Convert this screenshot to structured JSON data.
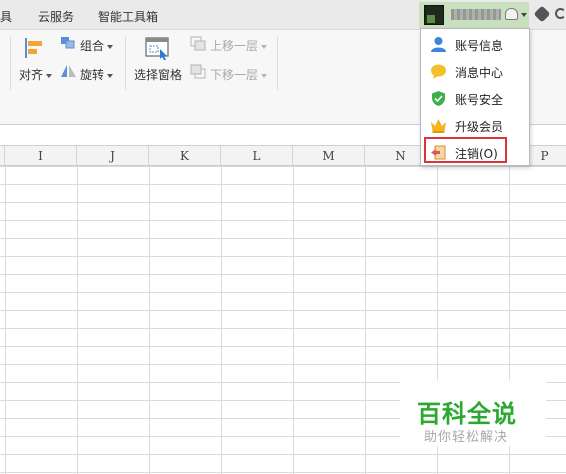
{
  "menubar": {
    "items": [
      "具",
      "云服务",
      "智能工具箱"
    ]
  },
  "toolbar": {
    "align_label": "对齐",
    "group_label": "组合",
    "rotate_label": "旋转",
    "selection_pane_label": "选择窗格",
    "move_up_label": "上移一层",
    "move_down_label": "下移一层"
  },
  "columns": [
    "I",
    "J",
    "K",
    "L",
    "M",
    "N",
    "P"
  ],
  "account_menu": {
    "items": [
      {
        "label": "账号信息",
        "icon": "user-icon"
      },
      {
        "label": "消息中心",
        "icon": "message-icon"
      },
      {
        "label": "账号安全",
        "icon": "shield-icon"
      },
      {
        "label": "升级会员",
        "icon": "crown-icon"
      },
      {
        "label": "注销(O)",
        "icon": "logout-icon"
      }
    ]
  },
  "watermark": {
    "title": "百科全说",
    "subtitle": "助你轻松解决"
  },
  "colors": {
    "highlight": "#d9343b",
    "watermark_green": "#2ba82e",
    "account_bg": "#c9e0c0"
  }
}
